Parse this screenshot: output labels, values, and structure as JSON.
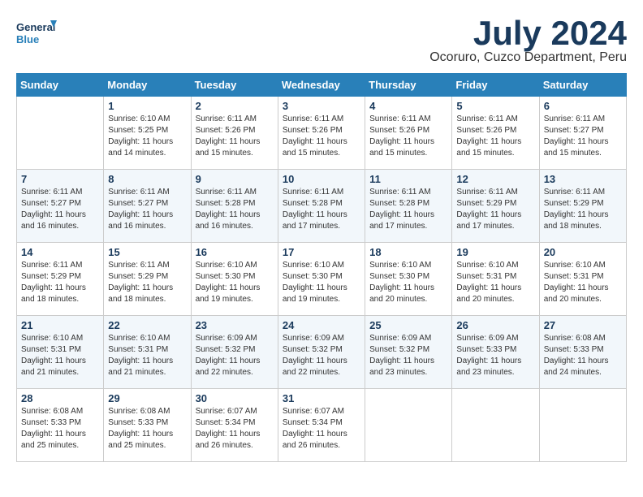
{
  "logo": {
    "line1": "General",
    "line2": "Blue"
  },
  "title": "July 2024",
  "location": "Ocoruro, Cuzco Department, Peru",
  "weekdays": [
    "Sunday",
    "Monday",
    "Tuesday",
    "Wednesday",
    "Thursday",
    "Friday",
    "Saturday"
  ],
  "weeks": [
    [
      {
        "day": "",
        "info": ""
      },
      {
        "day": "1",
        "info": "Sunrise: 6:10 AM\nSunset: 5:25 PM\nDaylight: 11 hours\nand 14 minutes."
      },
      {
        "day": "2",
        "info": "Sunrise: 6:11 AM\nSunset: 5:26 PM\nDaylight: 11 hours\nand 15 minutes."
      },
      {
        "day": "3",
        "info": "Sunrise: 6:11 AM\nSunset: 5:26 PM\nDaylight: 11 hours\nand 15 minutes."
      },
      {
        "day": "4",
        "info": "Sunrise: 6:11 AM\nSunset: 5:26 PM\nDaylight: 11 hours\nand 15 minutes."
      },
      {
        "day": "5",
        "info": "Sunrise: 6:11 AM\nSunset: 5:26 PM\nDaylight: 11 hours\nand 15 minutes."
      },
      {
        "day": "6",
        "info": "Sunrise: 6:11 AM\nSunset: 5:27 PM\nDaylight: 11 hours\nand 15 minutes."
      }
    ],
    [
      {
        "day": "7",
        "info": "Sunrise: 6:11 AM\nSunset: 5:27 PM\nDaylight: 11 hours\nand 16 minutes."
      },
      {
        "day": "8",
        "info": "Sunrise: 6:11 AM\nSunset: 5:27 PM\nDaylight: 11 hours\nand 16 minutes."
      },
      {
        "day": "9",
        "info": "Sunrise: 6:11 AM\nSunset: 5:28 PM\nDaylight: 11 hours\nand 16 minutes."
      },
      {
        "day": "10",
        "info": "Sunrise: 6:11 AM\nSunset: 5:28 PM\nDaylight: 11 hours\nand 17 minutes."
      },
      {
        "day": "11",
        "info": "Sunrise: 6:11 AM\nSunset: 5:28 PM\nDaylight: 11 hours\nand 17 minutes."
      },
      {
        "day": "12",
        "info": "Sunrise: 6:11 AM\nSunset: 5:29 PM\nDaylight: 11 hours\nand 17 minutes."
      },
      {
        "day": "13",
        "info": "Sunrise: 6:11 AM\nSunset: 5:29 PM\nDaylight: 11 hours\nand 18 minutes."
      }
    ],
    [
      {
        "day": "14",
        "info": "Sunrise: 6:11 AM\nSunset: 5:29 PM\nDaylight: 11 hours\nand 18 minutes."
      },
      {
        "day": "15",
        "info": "Sunrise: 6:11 AM\nSunset: 5:29 PM\nDaylight: 11 hours\nand 18 minutes."
      },
      {
        "day": "16",
        "info": "Sunrise: 6:10 AM\nSunset: 5:30 PM\nDaylight: 11 hours\nand 19 minutes."
      },
      {
        "day": "17",
        "info": "Sunrise: 6:10 AM\nSunset: 5:30 PM\nDaylight: 11 hours\nand 19 minutes."
      },
      {
        "day": "18",
        "info": "Sunrise: 6:10 AM\nSunset: 5:30 PM\nDaylight: 11 hours\nand 20 minutes."
      },
      {
        "day": "19",
        "info": "Sunrise: 6:10 AM\nSunset: 5:31 PM\nDaylight: 11 hours\nand 20 minutes."
      },
      {
        "day": "20",
        "info": "Sunrise: 6:10 AM\nSunset: 5:31 PM\nDaylight: 11 hours\nand 20 minutes."
      }
    ],
    [
      {
        "day": "21",
        "info": "Sunrise: 6:10 AM\nSunset: 5:31 PM\nDaylight: 11 hours\nand 21 minutes."
      },
      {
        "day": "22",
        "info": "Sunrise: 6:10 AM\nSunset: 5:31 PM\nDaylight: 11 hours\nand 21 minutes."
      },
      {
        "day": "23",
        "info": "Sunrise: 6:09 AM\nSunset: 5:32 PM\nDaylight: 11 hours\nand 22 minutes."
      },
      {
        "day": "24",
        "info": "Sunrise: 6:09 AM\nSunset: 5:32 PM\nDaylight: 11 hours\nand 22 minutes."
      },
      {
        "day": "25",
        "info": "Sunrise: 6:09 AM\nSunset: 5:32 PM\nDaylight: 11 hours\nand 23 minutes."
      },
      {
        "day": "26",
        "info": "Sunrise: 6:09 AM\nSunset: 5:33 PM\nDaylight: 11 hours\nand 23 minutes."
      },
      {
        "day": "27",
        "info": "Sunrise: 6:08 AM\nSunset: 5:33 PM\nDaylight: 11 hours\nand 24 minutes."
      }
    ],
    [
      {
        "day": "28",
        "info": "Sunrise: 6:08 AM\nSunset: 5:33 PM\nDaylight: 11 hours\nand 25 minutes."
      },
      {
        "day": "29",
        "info": "Sunrise: 6:08 AM\nSunset: 5:33 PM\nDaylight: 11 hours\nand 25 minutes."
      },
      {
        "day": "30",
        "info": "Sunrise: 6:07 AM\nSunset: 5:34 PM\nDaylight: 11 hours\nand 26 minutes."
      },
      {
        "day": "31",
        "info": "Sunrise: 6:07 AM\nSunset: 5:34 PM\nDaylight: 11 hours\nand 26 minutes."
      },
      {
        "day": "",
        "info": ""
      },
      {
        "day": "",
        "info": ""
      },
      {
        "day": "",
        "info": ""
      }
    ]
  ]
}
